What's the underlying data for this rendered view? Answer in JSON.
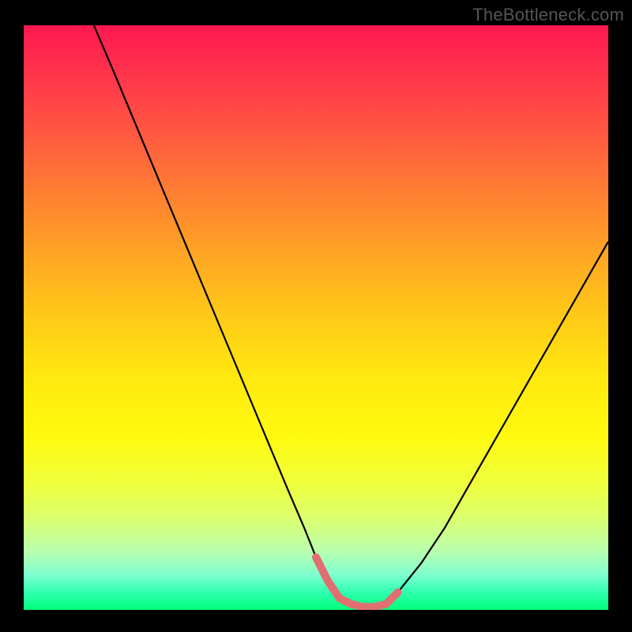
{
  "watermark": "TheBottleneck.com",
  "colors": {
    "frame": "#000000",
    "gradient_top": "#ff1850",
    "gradient_mid": "#ffe80f",
    "gradient_bottom": "#00ff7a",
    "curve": "#000000",
    "trough_highlight": "#e07070"
  },
  "chart_data": {
    "type": "line",
    "title": "",
    "xlabel": "",
    "ylabel": "",
    "xlim": [
      0,
      100
    ],
    "ylim": [
      0,
      100
    ],
    "series": [
      {
        "name": "bottleneck-curve",
        "x": [
          12,
          15,
          20,
          25,
          30,
          35,
          40,
          45,
          48,
          50,
          52,
          54,
          56,
          58,
          60,
          62,
          64,
          68,
          72,
          76,
          80,
          84,
          88,
          92,
          96,
          100
        ],
        "values": [
          100,
          93,
          81,
          69,
          57,
          45,
          33,
          21,
          14,
          9,
          5,
          2,
          1,
          0.5,
          0.5,
          1,
          3,
          8,
          14,
          21,
          28,
          35,
          42,
          49,
          56,
          63
        ]
      },
      {
        "name": "trough-highlight",
        "x": [
          50,
          52,
          54,
          56,
          58,
          60,
          62,
          64
        ],
        "values": [
          9,
          5,
          2,
          1,
          0.5,
          0.5,
          1,
          3
        ]
      }
    ]
  }
}
